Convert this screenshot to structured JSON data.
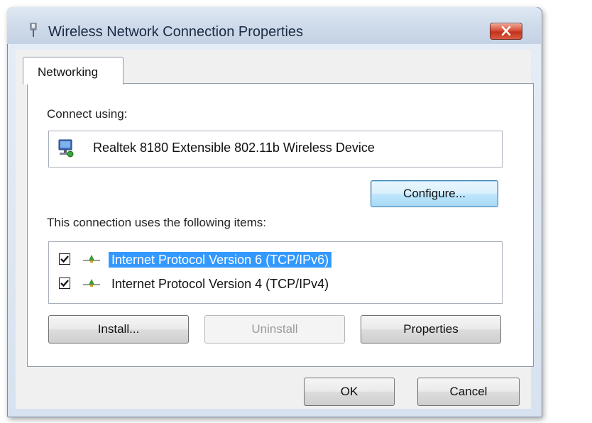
{
  "window": {
    "title": "Wireless Network Connection Properties",
    "close_label": "x"
  },
  "tabs": [
    {
      "label": "Networking",
      "active": true
    }
  ],
  "networking": {
    "connect_using_label": "Connect using:",
    "device_name": "Realtek 8180 Extensible 802.11b Wireless Device",
    "configure_label": "Configure...",
    "items_label": "This connection uses the following items:",
    "items": [
      {
        "label": "Internet Protocol Version 6 (TCP/IPv6)",
        "checked": true,
        "selected": true
      },
      {
        "label": "Internet Protocol Version 4 (TCP/IPv4)",
        "checked": true,
        "selected": false
      }
    ],
    "install_label": "Install...",
    "uninstall_label": "Uninstall",
    "properties_label": "Properties"
  },
  "footer": {
    "ok_label": "OK",
    "cancel_label": "Cancel"
  },
  "icons": {
    "title": "network-adapter-icon",
    "device": "network-device-icon",
    "protocol": "protocol-icon",
    "close": "close-icon"
  },
  "colors": {
    "selection": "#3399ff",
    "close_button": "#c2321c",
    "focus_button": "#3c7fb1"
  }
}
